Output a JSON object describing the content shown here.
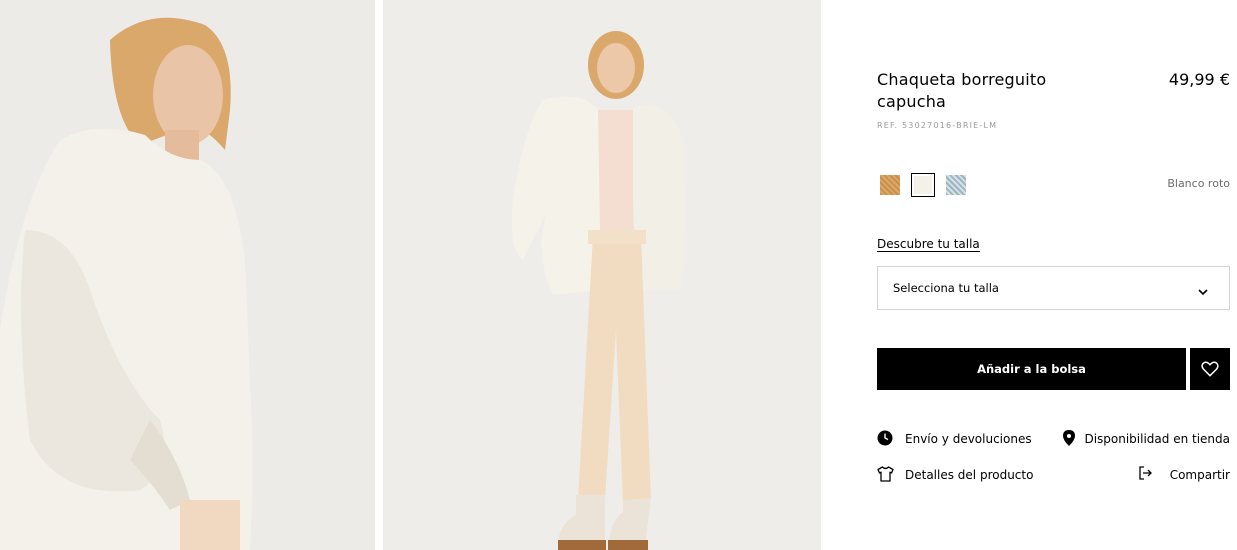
{
  "product": {
    "title": "Chaqueta borreguito capucha",
    "price": "49,99 €",
    "reference": "REF. 53027016-BRIE-LM",
    "selected_color": "Blanco roto"
  },
  "colors": [
    {
      "name": "camel",
      "hex": "#c98f4c"
    },
    {
      "name": "blanco-roto",
      "hex": "#f3f1e8"
    },
    {
      "name": "azul",
      "hex": "#b8ccd4"
    }
  ],
  "size": {
    "guide_label": "Descubre tu talla",
    "placeholder": "Selecciona tu talla"
  },
  "actions": {
    "add_to_bag": "Añadir a la bolsa"
  },
  "links": {
    "shipping": "Envío y devoluciones",
    "availability": "Disponibilidad en tienda",
    "details": "Detalles del producto",
    "share": "Compartir"
  },
  "icons": {
    "wishlist": "heart-icon",
    "shipping": "clock-icon",
    "availability": "location-pin-icon",
    "details": "tshirt-icon",
    "share": "share-arrow-icon",
    "select": "chevron-down-icon"
  }
}
